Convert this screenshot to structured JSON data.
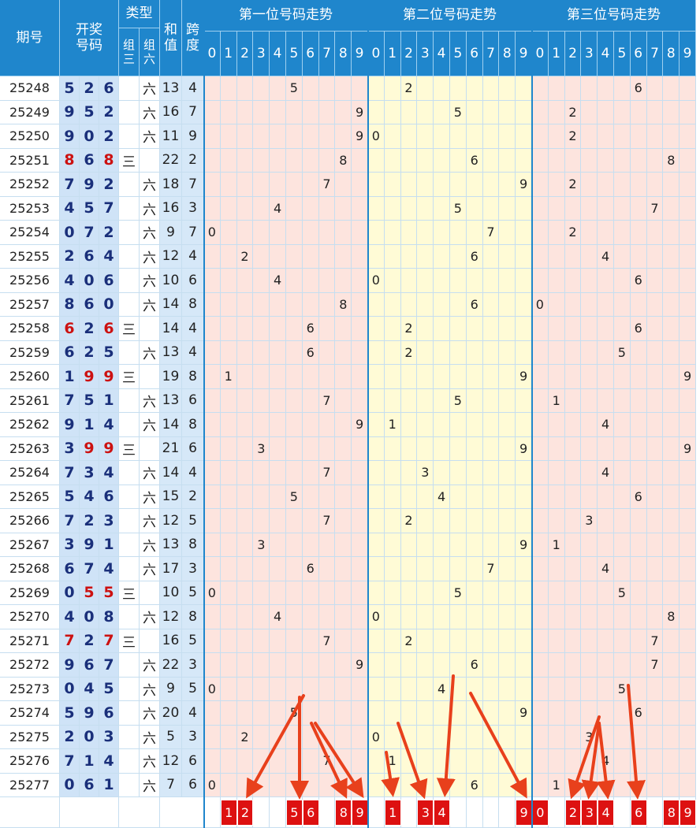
{
  "header": {
    "issue": "期号",
    "draw_line1": "开奖",
    "draw_line2": "号码",
    "type": "类型",
    "type_pair_1": "组",
    "type_pair_2": "三",
    "type_six_1": "组",
    "type_six_2": "六",
    "sum_1": "和",
    "sum_2": "值",
    "span_1": "跨",
    "span_2": "度",
    "zones": [
      "第一位号码走势",
      "第二位号码走势",
      "第三位号码走势"
    ],
    "digits": [
      "0",
      "1",
      "2",
      "3",
      "4",
      "5",
      "6",
      "7",
      "8",
      "9"
    ]
  },
  "type_labels": {
    "pair": "三",
    "six": "六"
  },
  "colors": {
    "header_blue": "#1f86cc",
    "draw_blue_text": "#1a2f7a",
    "repeat_red": "#cc1111",
    "zone_pink": "#fde4de",
    "zone_yellow": "#fffbd6",
    "marker_red": "#dd1111",
    "arrow_red": "#e8401c"
  },
  "chart_data": {
    "type": "table",
    "columns": [
      "期号",
      "开奖号码",
      "类型",
      "和值",
      "跨度"
    ],
    "rows": [
      {
        "issue": "25248",
        "draw": [
          5,
          2,
          6
        ],
        "type": "六",
        "sum": 13,
        "span": 4
      },
      {
        "issue": "25249",
        "draw": [
          9,
          5,
          2
        ],
        "type": "六",
        "sum": 16,
        "span": 7
      },
      {
        "issue": "25250",
        "draw": [
          9,
          0,
          2
        ],
        "type": "六",
        "sum": 11,
        "span": 9
      },
      {
        "issue": "25251",
        "draw": [
          8,
          6,
          8
        ],
        "type": "三",
        "sum": 22,
        "span": 2
      },
      {
        "issue": "25252",
        "draw": [
          7,
          9,
          2
        ],
        "type": "六",
        "sum": 18,
        "span": 7
      },
      {
        "issue": "25253",
        "draw": [
          4,
          5,
          7
        ],
        "type": "六",
        "sum": 16,
        "span": 3
      },
      {
        "issue": "25254",
        "draw": [
          0,
          7,
          2
        ],
        "type": "六",
        "sum": 9,
        "span": 7
      },
      {
        "issue": "25255",
        "draw": [
          2,
          6,
          4
        ],
        "type": "六",
        "sum": 12,
        "span": 4
      },
      {
        "issue": "25256",
        "draw": [
          4,
          0,
          6
        ],
        "type": "六",
        "sum": 10,
        "span": 6
      },
      {
        "issue": "25257",
        "draw": [
          8,
          6,
          0
        ],
        "type": "六",
        "sum": 14,
        "span": 8
      },
      {
        "issue": "25258",
        "draw": [
          6,
          2,
          6
        ],
        "type": "三",
        "sum": 14,
        "span": 4
      },
      {
        "issue": "25259",
        "draw": [
          6,
          2,
          5
        ],
        "type": "六",
        "sum": 13,
        "span": 4
      },
      {
        "issue": "25260",
        "draw": [
          1,
          9,
          9
        ],
        "type": "三",
        "sum": 19,
        "span": 8
      },
      {
        "issue": "25261",
        "draw": [
          7,
          5,
          1
        ],
        "type": "六",
        "sum": 13,
        "span": 6
      },
      {
        "issue": "25262",
        "draw": [
          9,
          1,
          4
        ],
        "type": "六",
        "sum": 14,
        "span": 8
      },
      {
        "issue": "25263",
        "draw": [
          3,
          9,
          9
        ],
        "type": "三",
        "sum": 21,
        "span": 6
      },
      {
        "issue": "25264",
        "draw": [
          7,
          3,
          4
        ],
        "type": "六",
        "sum": 14,
        "span": 4
      },
      {
        "issue": "25265",
        "draw": [
          5,
          4,
          6
        ],
        "type": "六",
        "sum": 15,
        "span": 2
      },
      {
        "issue": "25266",
        "draw": [
          7,
          2,
          3
        ],
        "type": "六",
        "sum": 12,
        "span": 5
      },
      {
        "issue": "25267",
        "draw": [
          3,
          9,
          1
        ],
        "type": "六",
        "sum": 13,
        "span": 8
      },
      {
        "issue": "25268",
        "draw": [
          6,
          7,
          4
        ],
        "type": "六",
        "sum": 17,
        "span": 3
      },
      {
        "issue": "25269",
        "draw": [
          0,
          5,
          5
        ],
        "type": "三",
        "sum": 10,
        "span": 5
      },
      {
        "issue": "25270",
        "draw": [
          4,
          0,
          8
        ],
        "type": "六",
        "sum": 12,
        "span": 8
      },
      {
        "issue": "25271",
        "draw": [
          7,
          2,
          7
        ],
        "type": "三",
        "sum": 16,
        "span": 5
      },
      {
        "issue": "25272",
        "draw": [
          9,
          6,
          7
        ],
        "type": "六",
        "sum": 22,
        "span": 3
      },
      {
        "issue": "25273",
        "draw": [
          0,
          4,
          5
        ],
        "type": "六",
        "sum": 9,
        "span": 5
      },
      {
        "issue": "25274",
        "draw": [
          5,
          9,
          6
        ],
        "type": "六",
        "sum": 20,
        "span": 4
      },
      {
        "issue": "25275",
        "draw": [
          2,
          0,
          3
        ],
        "type": "六",
        "sum": 5,
        "span": 3
      },
      {
        "issue": "25276",
        "draw": [
          7,
          1,
          4
        ],
        "type": "六",
        "sum": 12,
        "span": 6
      },
      {
        "issue": "25277",
        "draw": [
          0,
          6,
          1
        ],
        "type": "六",
        "sum": 7,
        "span": 6
      }
    ],
    "predictions": [
      [
        1,
        2,
        5,
        6,
        8,
        9
      ],
      [
        1,
        3,
        4,
        9
      ],
      [
        0,
        2,
        3,
        4,
        6,
        8,
        9
      ]
    ]
  }
}
